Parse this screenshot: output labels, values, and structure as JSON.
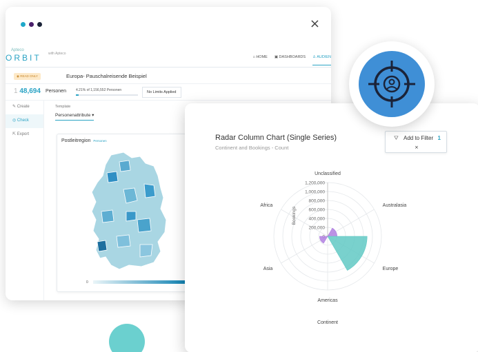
{
  "window": {
    "close_glyph": "×"
  },
  "app": {
    "brand_small": "Apteco",
    "brand_main": "ORBIT",
    "brand_with": "with Apteco",
    "nav": [
      {
        "label": "HOME",
        "icon": "home-icon"
      },
      {
        "label": "DASHBOARDS",
        "icon": "dashboard-icon"
      },
      {
        "label": "AUDIEN",
        "icon": "audience-icon"
      }
    ],
    "read_only": "READ ONLY",
    "audience_title": "Europa- Pauschalreisende Beispiel",
    "count_prefix": "1",
    "count": "48,694",
    "count_unit": "Personen",
    "percent_text": "4.21% of 1,156,552 Personen",
    "percent_value": 4.21,
    "limits": "No Limits Applied",
    "side_items": [
      {
        "label": "Create",
        "icon": "create-icon"
      },
      {
        "label": "Check",
        "icon": "eye-icon"
      },
      {
        "label": "Export",
        "icon": "export-icon"
      }
    ],
    "template_label": "Template",
    "template_value": "Personenattribute",
    "map_title": "Postleitregion",
    "map_subtitle": "Personen",
    "scale_min": "0"
  },
  "filter": {
    "label": "Add to Filter",
    "count": "1",
    "remove": "×"
  },
  "chart_data": {
    "type": "radar-column",
    "title": "Radar Column Chart (Single Series)",
    "subtitle": "Continent and Bookings - Count",
    "axis_title": "Bookings",
    "xlabel": "Continent",
    "categories": [
      "Unclassified",
      "Australasia",
      "Europe",
      "Americas",
      "Asia",
      "Africa"
    ],
    "values": [
      0,
      210000,
      880000,
      0,
      180000,
      0
    ],
    "colors": [
      "#b07fe0",
      "#b07fe0",
      "#62c9c4",
      "#b07fe0",
      "#b07fe0",
      "#b07fe0"
    ],
    "ticks": [
      "1,200,000",
      "1,000,000",
      "800,000",
      "600,000",
      "400,000",
      "200,000",
      "0"
    ],
    "ylim": [
      0,
      1200000
    ]
  },
  "colors": {
    "accent": "#2aa3c4",
    "teal": "#62c9c4",
    "purple": "#b07fe0",
    "badge": "#3f8fd6"
  }
}
